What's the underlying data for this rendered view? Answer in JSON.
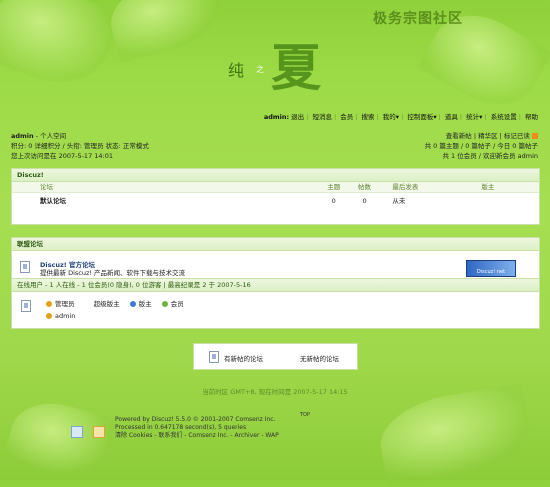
{
  "header": {
    "logo": "极务宗图社区",
    "chun": "纯",
    "zhi": "之",
    "xia": "夏"
  },
  "topnav": [
    "admin:",
    "退出",
    "短消息",
    "会员",
    "搜索",
    "我的▾",
    "控制面板▾",
    "道具",
    "统计▾",
    "系统设置",
    "帮助"
  ],
  "user": {
    "name": "admin",
    "space": "- 个人空间",
    "line2": "积分: 0 详细积分 / 头衔: 管理员 状态: 正常模式",
    "line3": "您上次访问是在 2007-5-17 14:01"
  },
  "right_links": {
    "line1": "查看新帖 | 精华区 | 标记已读",
    "line2": "共 0 篇主题 / 0 篇帖子 / 今日 0 篇帖子",
    "line3": "共 1 位会员 / 欢迎新会员 admin"
  },
  "discuz_panel": {
    "title": "Discuz!",
    "columns": [
      "论坛",
      "主题",
      "帖数",
      "最后发表",
      "版主"
    ],
    "rows": [
      {
        "name": "默认论坛",
        "topics": "0",
        "posts": "0",
        "last": "从未",
        "mod": ""
      }
    ]
  },
  "alliance_panel": {
    "title": "联盟论坛",
    "site_name": "Discuz! 官方论坛",
    "site_desc": "提供最新 Discuz! 产品新闻、软件下载与技术交流",
    "banner": "Discuz! net"
  },
  "online": {
    "bar": "在线用户 - 1 人在线 - 1 位会员(0 隐身), 0 位游客 | 最高纪录是 2 于 2007-5-16",
    "legend": [
      "管理员",
      "超级版主",
      "版主",
      "会员"
    ],
    "users": [
      "admin"
    ]
  },
  "legend_box": {
    "new": "有新帖的论坛",
    "none": "无新帖的论坛"
  },
  "footer": {
    "time": "当前时区 GMT+8, 现在时间是 2007-5-17 14:15",
    "power1": "Powered by Discuz! 5.5.0 © 2001-2007 Comsenz Inc.",
    "power2": "Processed in 0.647178 second(s), 5 queries",
    "power3": "清除 Cookies - 联系我们 - Comsenz Inc. - Archiver - WAP",
    "top": "TOP"
  },
  "colors": {
    "bg": "#9edb48",
    "panel_head": "#dcefc4",
    "link": "#2c5b0f"
  }
}
